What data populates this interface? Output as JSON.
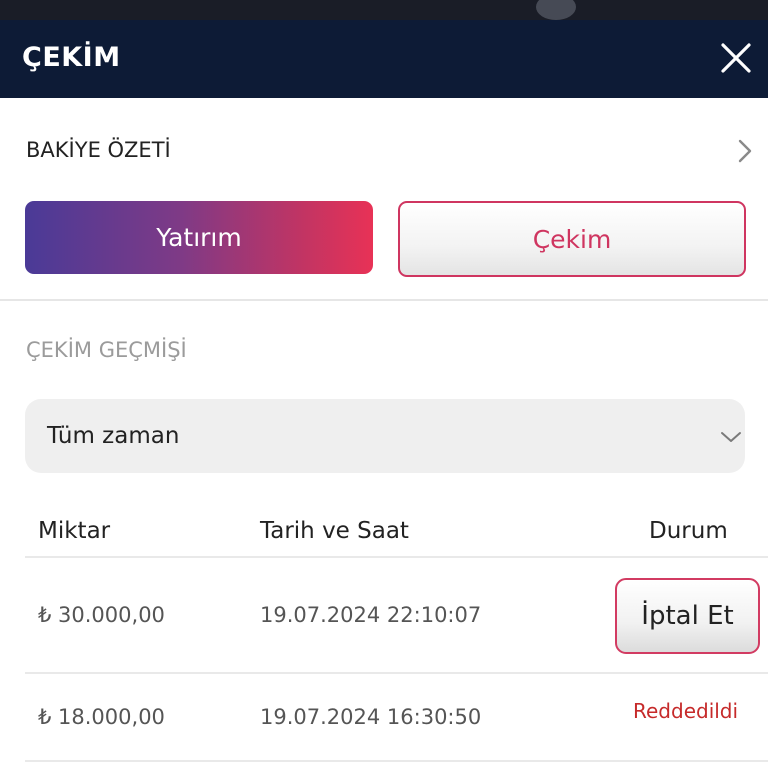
{
  "header": {
    "title": "ÇEKİM",
    "close_icon": "close-icon"
  },
  "summary": {
    "label": "BAKİYE ÖZETİ",
    "icon": "chevron-right-icon"
  },
  "actions": {
    "deposit_label": "Yatırım",
    "withdraw_label": "Çekim"
  },
  "history": {
    "title": "ÇEKİM GEÇMİŞİ",
    "filter": {
      "selected": "Tüm zaman",
      "icon": "chevron-down-icon"
    },
    "columns": {
      "amount": "Miktar",
      "date": "Tarih ve Saat",
      "status": "Durum"
    },
    "rows": [
      {
        "amount": "₺ 30.000,00",
        "date": "19.07.2024 22:10:07",
        "status_button": "İptal Et"
      },
      {
        "amount": "₺ 18.000,00",
        "date": "19.07.2024 16:30:50",
        "status": "Reddedildi"
      }
    ]
  },
  "colors": {
    "header_bg": "#0d1b36",
    "accent": "#cf3560",
    "deposit_gradient_start": "#4a3a97",
    "deposit_gradient_end": "#e83256",
    "rejected": "#c62a2a"
  }
}
